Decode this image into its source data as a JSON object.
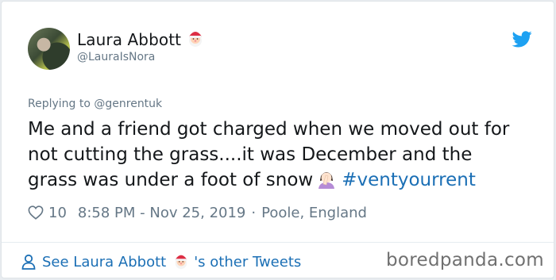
{
  "tweet": {
    "author_name": "Laura Abbott",
    "handle": "@LauraIsNora",
    "replying_to": "Replying to @genrentuk",
    "text_line1": "Me and a friend got charged when we moved out for",
    "text_line2": "not cutting the grass....it was December and the",
    "text_line3": "grass was under a foot of snow",
    "hashtag": "#ventyourrent",
    "likes": "10",
    "timestamp": "8:58 PM - Nov 25, 2019",
    "separator": "·",
    "location": "Poole, England"
  },
  "footer": {
    "link_prefix": "See Laura Abbott",
    "link_suffix": "'s other Tweets"
  },
  "watermark": "boredpanda.com",
  "icons": {
    "name_emoji": "santa-emoji-icon",
    "inline_emoji": "facepalm-woman-emoji-icon",
    "platform": "twitter-bird-icon",
    "like": "heart-outline-icon",
    "user": "user-outline-icon"
  },
  "colors": {
    "link_blue": "#1b6fb5",
    "twitter_blue": "#1da1f2",
    "muted": "#657786",
    "text": "#14171a"
  }
}
